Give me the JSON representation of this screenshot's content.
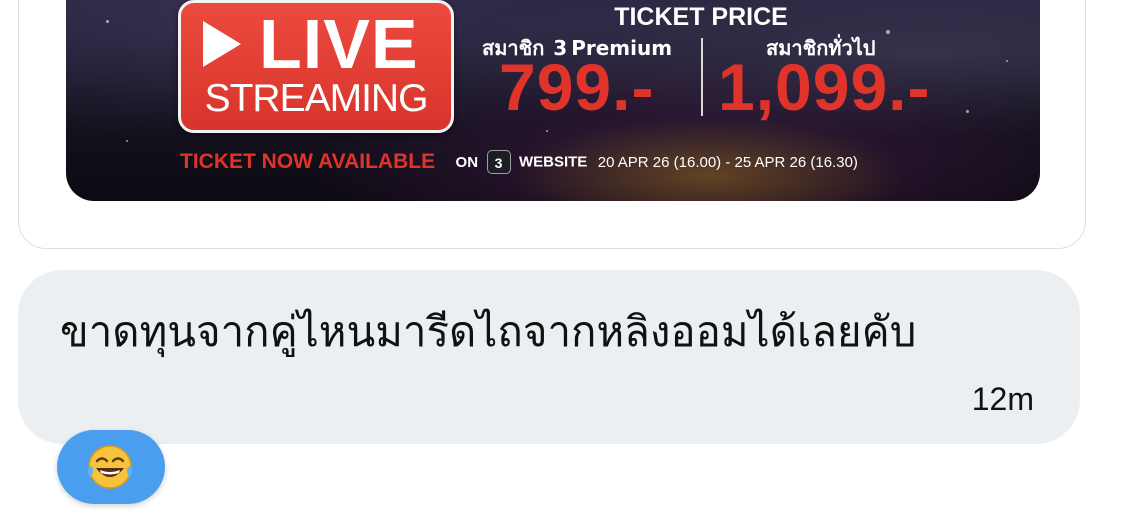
{
  "banner": {
    "live_label": "LIVE",
    "streaming_label": "STREAMING",
    "ticket_price_title": "TICKET PRICE",
    "member_label_prefix": "สมาชิก",
    "member_label_num": "3",
    "member_label_suffix": "Premium",
    "member_price": "799.-",
    "general_label": "สมาชิกทั่วไป",
    "general_price": "1,099.-",
    "ticket_now": "TICKET NOW AVAILABLE",
    "on_label": "ON",
    "app_icon_num": "3",
    "website_label": "WEBSITE",
    "dates": "20 APR 26 (16.00) - 25 APR 26 (16.30)",
    "accent_color": "#e0342a"
  },
  "message": {
    "text": "ขาดทุนจากคู่ไหนมารีดไถจากหลิงออมได้เลยคับ",
    "time": "12m",
    "bubble_color": "#eceff1"
  },
  "reaction": {
    "icon": "face-with-tears-of-joy-icon",
    "color": "#4a9ef0"
  }
}
